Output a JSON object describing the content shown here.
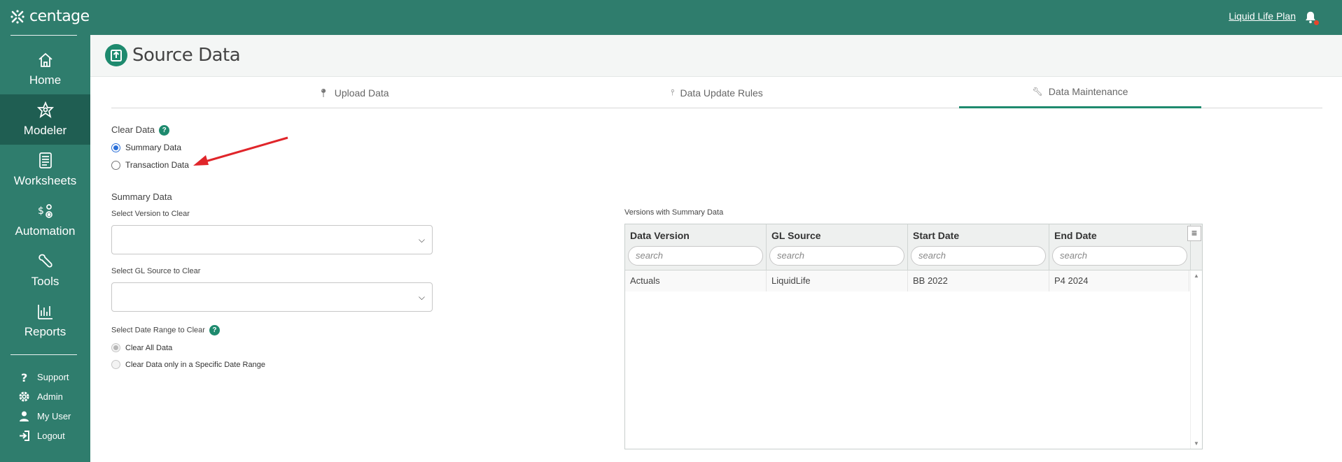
{
  "brand": {
    "name": "centage"
  },
  "topbar": {
    "plan_link": "Liquid Life Plan"
  },
  "sidebar": {
    "items": [
      {
        "label": "Home",
        "icon": "home-icon"
      },
      {
        "label": "Modeler",
        "icon": "modeler-icon"
      },
      {
        "label": "Worksheets",
        "icon": "worksheets-icon"
      },
      {
        "label": "Automation",
        "icon": "automation-icon"
      },
      {
        "label": "Tools",
        "icon": "tools-icon"
      },
      {
        "label": "Reports",
        "icon": "reports-icon"
      }
    ],
    "utility": [
      {
        "label": "Support",
        "icon": "question-icon"
      },
      {
        "label": "Admin",
        "icon": "gear-icon"
      },
      {
        "label": "My User",
        "icon": "user-icon"
      },
      {
        "label": "Logout",
        "icon": "logout-icon"
      }
    ]
  },
  "header": {
    "title": "Source Data"
  },
  "tabs": [
    {
      "label": "Upload Data"
    },
    {
      "label": "Data Update Rules"
    },
    {
      "label": "Data Maintenance",
      "active": true
    }
  ],
  "clear_data": {
    "label": "Clear Data",
    "help": "?",
    "options": [
      "Summary Data",
      "Transaction Data"
    ],
    "selected": "Summary Data"
  },
  "summary": {
    "heading": "Summary Data",
    "version_label": "Select Version to Clear",
    "version_value": "",
    "gl_label": "Select GL Source to Clear",
    "gl_value": "",
    "date_range_label": "Select Date Range to Clear",
    "date_options": [
      "Clear All Data",
      "Clear Data only in a Specific Date Range"
    ],
    "date_selected": "Clear All Data"
  },
  "versions_grid": {
    "title": "Versions with Summary Data",
    "columns": [
      "Data Version",
      "GL Source",
      "Start Date",
      "End Date"
    ],
    "filter_placeholder": "search",
    "rows": [
      [
        "Actuals",
        "LiquidLife",
        "BB 2022",
        "P4 2024"
      ]
    ]
  },
  "colors": {
    "brand": "#2f7d6d",
    "active_nav": "#1f5e52",
    "accent": "#1e8a6e",
    "annotation_arrow": "#e0252a"
  }
}
